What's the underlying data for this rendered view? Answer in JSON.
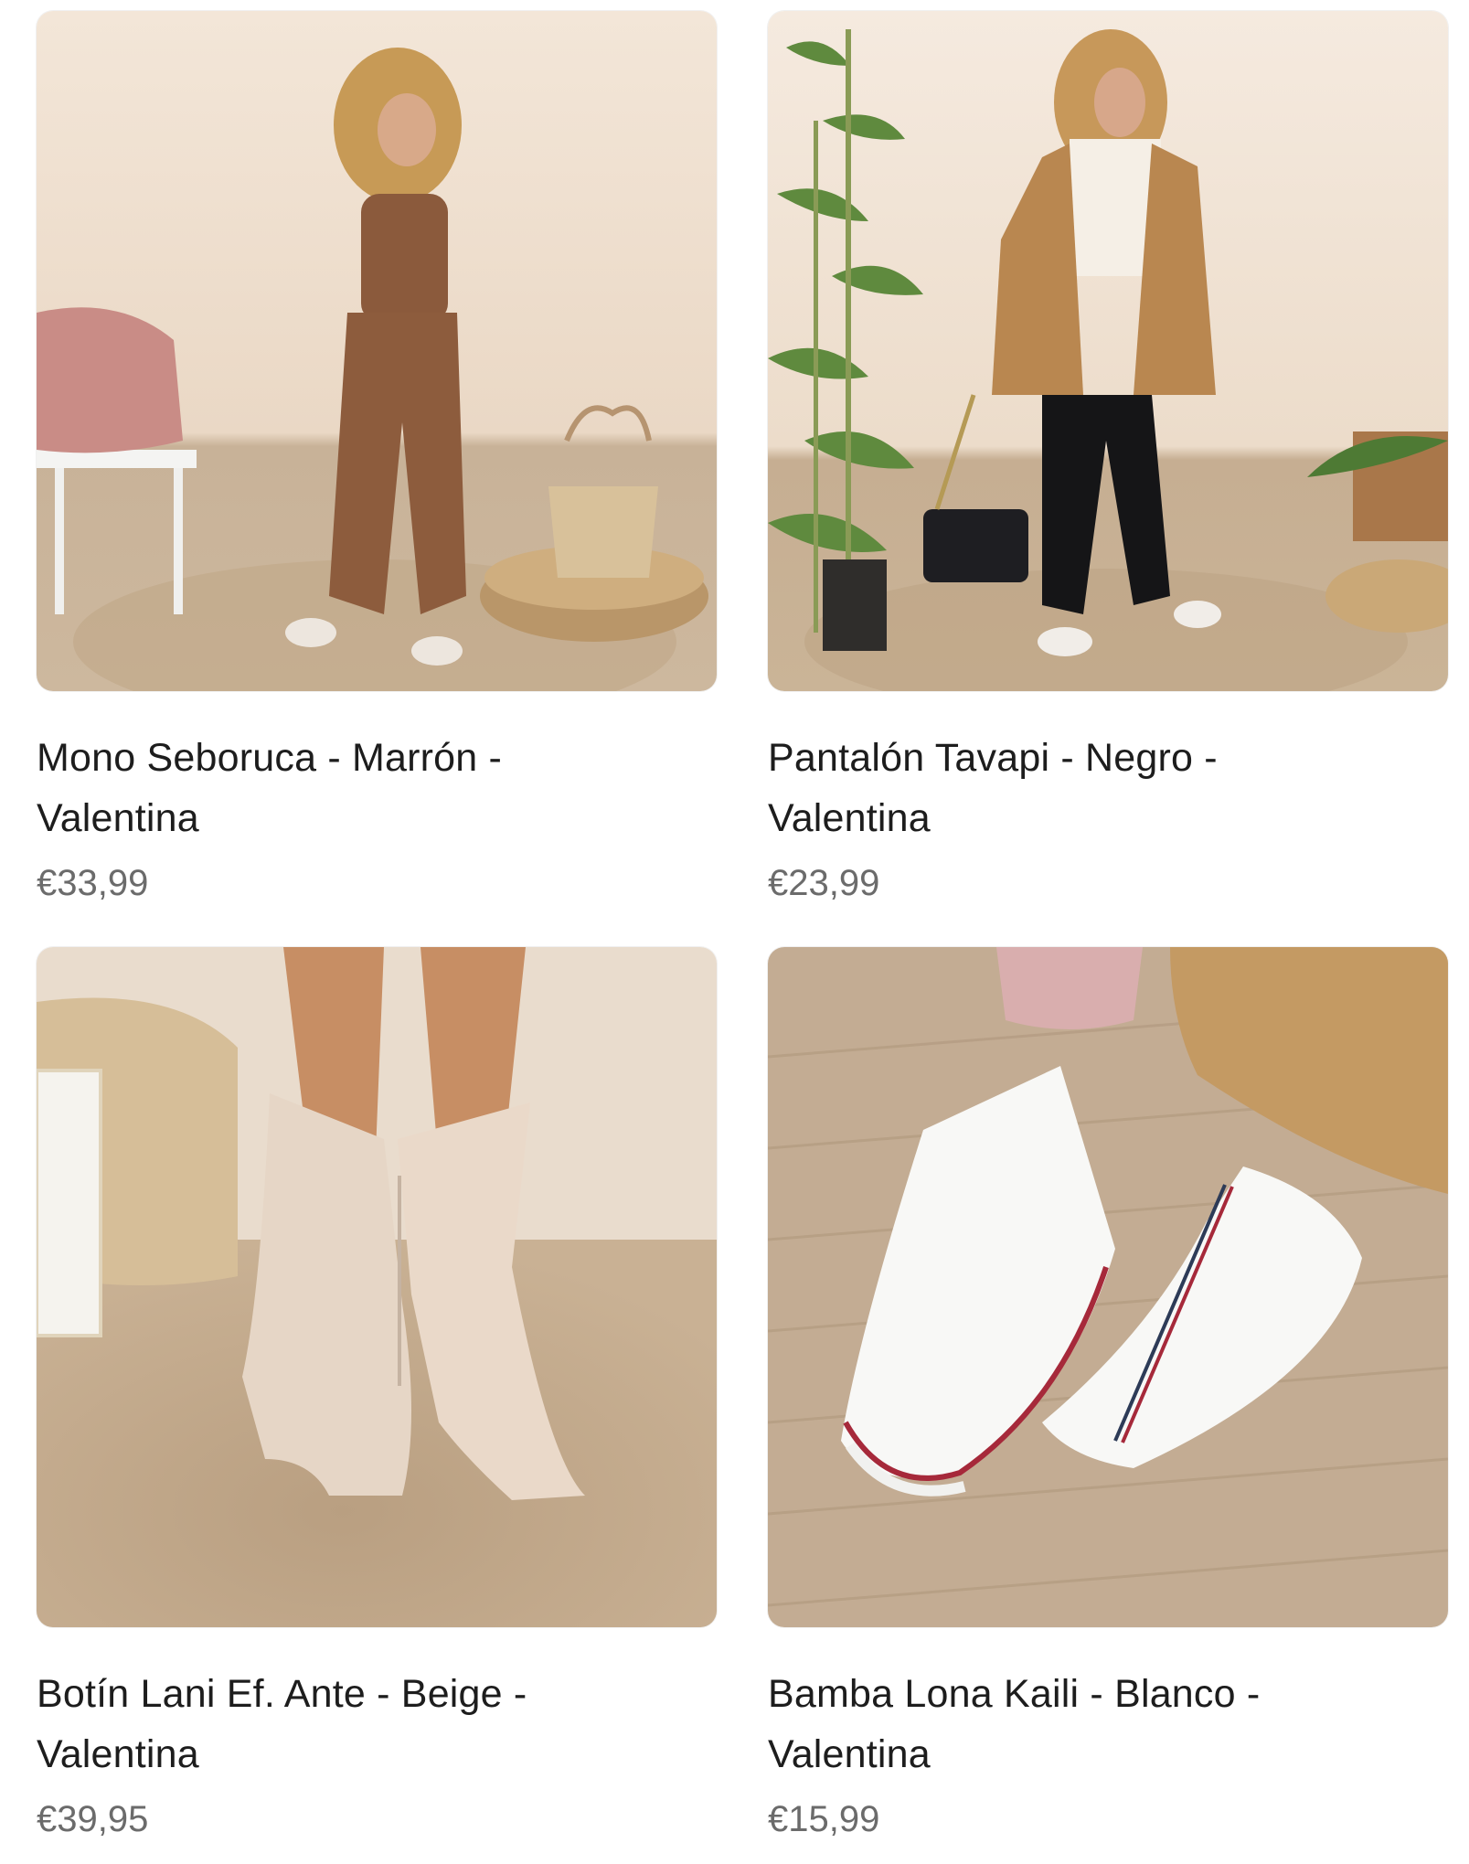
{
  "products": [
    {
      "title": "Mono Seboruca - Marrón - Valentina",
      "price": "€33,99",
      "image": "model-brown-overalls"
    },
    {
      "title": "Pantalón Tavapi - Negro - Valentina",
      "price": "€23,99",
      "image": "model-camel-coat-black-pants"
    },
    {
      "title": "Botín Lani Ef. Ante - Beige - Valentina",
      "price": "€39,95",
      "image": "beige-suede-ankle-boots"
    },
    {
      "title": "Bamba Lona Kaili - Blanco - Valentina",
      "price": "€15,99",
      "image": "white-canvas-high-top-sneakers"
    }
  ],
  "colors": {
    "title": "#1d1d1d",
    "price": "#6b6b6b",
    "backdrop": "#efe1d2",
    "jute_rug": "#c9b397"
  }
}
